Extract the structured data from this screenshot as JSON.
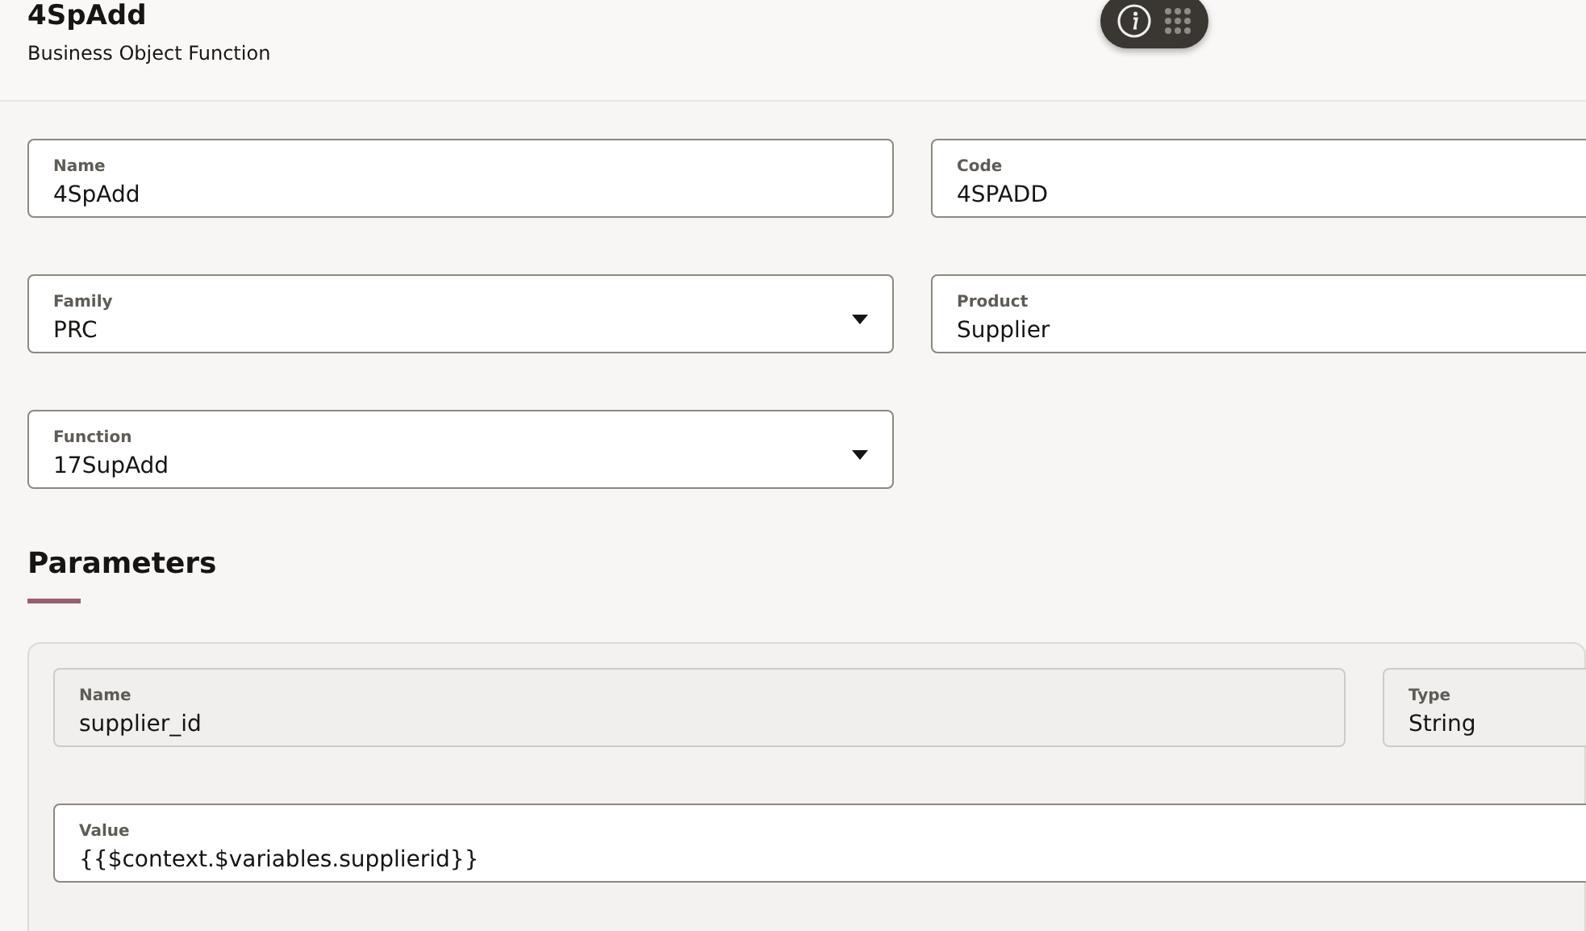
{
  "header": {
    "title": "4SpAdd",
    "subtitle": "Business Object Function"
  },
  "form": [
    [
      {
        "label": "Name",
        "value": "4SpAdd",
        "kind": "text"
      },
      {
        "label": "Code",
        "value": "4SPADD",
        "kind": "text"
      }
    ],
    [
      {
        "label": "Family",
        "value": "PRC",
        "kind": "select"
      },
      {
        "label": "Product",
        "value": "Supplier",
        "kind": "text"
      }
    ],
    [
      {
        "label": "Function",
        "value": "17SupAdd",
        "kind": "select"
      }
    ]
  ],
  "parameters": {
    "heading": "Parameters",
    "rows": [
      [
        {
          "label": "Name",
          "value": "supplier_id",
          "kind": "readonly"
        },
        {
          "label": "Type",
          "value": "String",
          "kind": "readonly"
        }
      ],
      [
        {
          "label": "Value",
          "value": "{{$context.$variables.supplierid}}",
          "kind": "text"
        }
      ]
    ]
  }
}
